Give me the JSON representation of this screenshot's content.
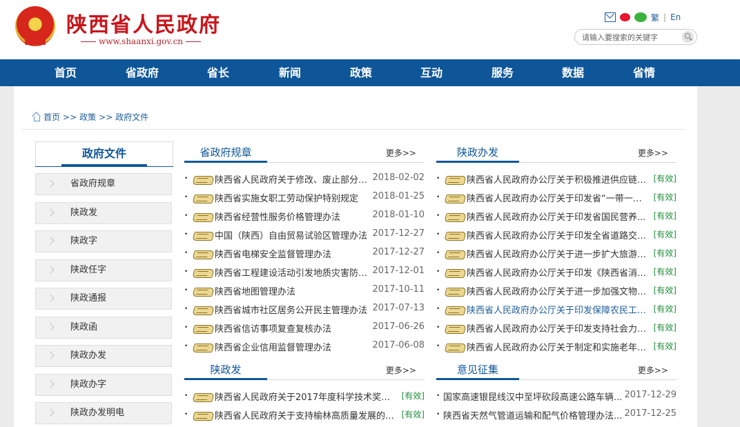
{
  "header": {
    "site_title": "陕西省人民政府",
    "site_url": "www.shaanxi.gov.cn",
    "links": {
      "traditional": "繁",
      "english": "En",
      "divider": "|"
    },
    "search_placeholder": "请输入要搜索的关键字",
    "icons": [
      "mail-icon",
      "weibo-icon",
      "wechat-icon",
      "search-icon"
    ]
  },
  "nav": [
    "首页",
    "省政府",
    "省长",
    "新闻",
    "政策",
    "互动",
    "服务",
    "数据",
    "省情"
  ],
  "breadcrumb": {
    "items": [
      "首页",
      "政策",
      "政府文件"
    ],
    "separator": ">>"
  },
  "sidebar": {
    "title": "政府文件",
    "items": [
      "省政府规章",
      "陕政发",
      "陕政字",
      "陕政任字",
      "陕政通报",
      "陕政函",
      "陕政办发",
      "陕政办字",
      "陕政办发明电"
    ]
  },
  "sections": [
    {
      "title": "省政府规章",
      "more": "更多>>",
      "items": [
        {
          "title": "陕西省人民政府关于修改、废止部分省...",
          "date": "2018-02-02"
        },
        {
          "title": "陕西省实施女职工劳动保护特别规定",
          "date": "2018-01-25"
        },
        {
          "title": "陕西省经营性服务价格管理办法",
          "date": "2018-01-10"
        },
        {
          "title": "中国（陕西）自由贸易试验区管理办法",
          "date": "2017-12-27"
        },
        {
          "title": "陕西省电梯安全监督管理办法",
          "date": "2017-12-27"
        },
        {
          "title": "陕西省工程建设活动引发地质灾害防治...",
          "date": "2017-12-01"
        },
        {
          "title": "陕西省地图管理办法",
          "date": "2017-10-11"
        },
        {
          "title": "陕西省城市社区居务公开民主管理办法",
          "date": "2017-07-13"
        },
        {
          "title": "陕西省信访事项复查复核办法",
          "date": "2017-06-26"
        },
        {
          "title": "陕西省企业信用监督管理办法",
          "date": "2017-06-08"
        }
      ]
    },
    {
      "title": "陕政办发",
      "more": "更多>>",
      "items": [
        {
          "title": "陕西省人民政府办公厅关于积极推进供应链创...",
          "status": "[有效]"
        },
        {
          "title": "陕西省人民政府办公厅关于印发省“一带一路...",
          "status": "[有效]"
        },
        {
          "title": "陕西省人民政府办公厅关于印发省国民营养...",
          "status": "[有效]"
        },
        {
          "title": "陕西省人民政府办公厅关于印发全省道路交通...",
          "status": "[有效]"
        },
        {
          "title": "陕西省人民政府办公厅关于进一步扩大旅游文...",
          "status": "[有效]"
        },
        {
          "title": "陕西省人民政府办公厅关于印发《陕西省消防...",
          "status": "[有效]"
        },
        {
          "title": "陕西省人民政府办公厅关于进一步加强文物安...",
          "status": "[有效]"
        },
        {
          "title": "陕西省人民政府办公厅关于印发保障农民工工...",
          "status": "[有效]",
          "highlight": true
        },
        {
          "title": "陕西省人民政府办公厅关于印发支持社会力量...",
          "status": "[有效]"
        },
        {
          "title": "陕西省人民政府办公厅关于制定和实施老年人...",
          "status": "[有效]"
        }
      ]
    },
    {
      "title": "陕政发",
      "more": "更多>>",
      "items": [
        {
          "title": "陕西省人民政府关于2017年度科学技术奖励的...",
          "status": "[有效]"
        },
        {
          "title": "陕西省人民政府关于支持榆林高质量发展的意...",
          "status": "[有效]"
        }
      ]
    },
    {
      "title": "意见征集",
      "more": "更多>>",
      "items": [
        {
          "title": "国家高速银昆线汉中至坪砍段高速公路车辆...",
          "date": "2017-12-29"
        },
        {
          "title": "陕西省天然气管道运输和配气价格管理办法...",
          "date": "2017-12-25"
        }
      ]
    }
  ]
}
